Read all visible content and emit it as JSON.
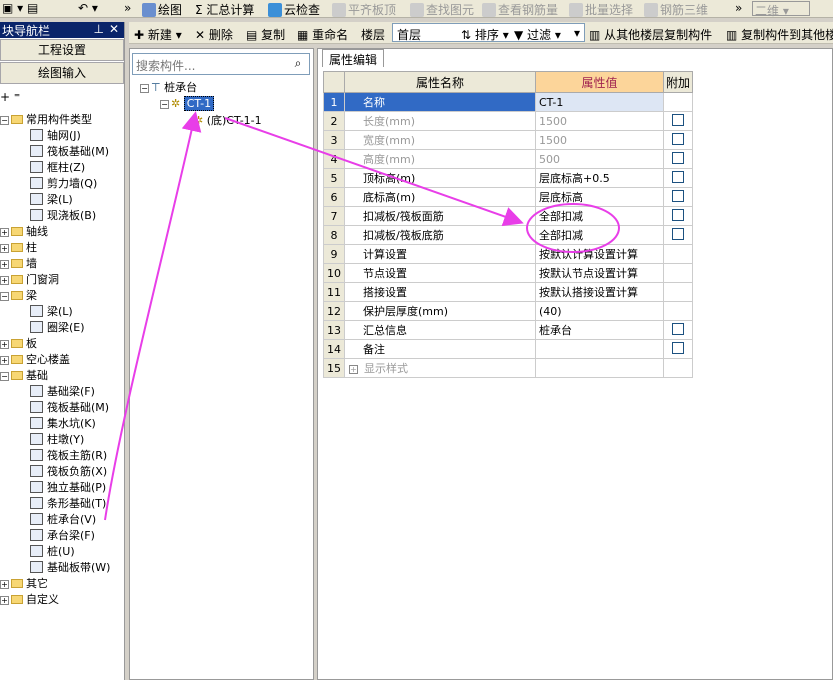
{
  "toolbar": {
    "items": [
      "绘图",
      "汇总计算",
      "云检查",
      "平齐板顶",
      "查找图元",
      "查看钢筋量",
      "批量选择",
      "钢筋三维"
    ],
    "view_mode": "二维"
  },
  "nav": {
    "title": "模块导航栏",
    "title_visible": "块导航栏",
    "btn_project": "工程设置",
    "btn_draw": "绘图输入",
    "items": {
      "common": "常用构件类型",
      "grid": "轴网(J)",
      "raft": "筏板基础(M)",
      "column_frame": "框柱(Z)",
      "shear_wall": "剪力墙(Q)",
      "beam": "梁(L)",
      "slab": "现浇板(B)",
      "axis": "轴线",
      "col": "柱",
      "wall": "墙",
      "door": "门窗洞",
      "beam_group": "梁",
      "beam_l": "梁(L)",
      "ring_beam": "圈梁(E)",
      "board": "板",
      "hollow": "空心楼盖",
      "found": "基础",
      "found_beam": "基础梁(F)",
      "raft2": "筏板基础(M)",
      "sump": "集水坑(K)",
      "pier": "柱墩(Y)",
      "raft_main": "筏板主筋(R)",
      "raft_neg": "筏板负筋(X)",
      "isolated": "独立基础(P)",
      "strip": "条形基础(T)",
      "pile_cap": "桩承台(V)",
      "cap_beam": "承台梁(F)",
      "pile": "桩(U)",
      "found_strip": "基础板带(W)",
      "other": "其它",
      "custom": "自定义"
    }
  },
  "mid": {
    "search_placeholder": "搜索构件...",
    "root": "桩承台",
    "child": "CT-1",
    "sub": "(底)CT-1-1"
  },
  "tb2": {
    "new": "新建",
    "delete": "删除",
    "copy": "复制",
    "rename": "重命名",
    "floor_label": "楼层",
    "floor_value": "首层",
    "sort": "排序",
    "filter": "过滤",
    "copy_from": "从其他楼层复制构件",
    "copy_to": "复制构件到其他楼层"
  },
  "panel": {
    "tab": "属性编辑",
    "headers": [
      "属性名称",
      "属性值",
      "附加"
    ],
    "rows": [
      {
        "n": "1",
        "name": "名称",
        "value": "CT-1",
        "cb": false,
        "gray": false
      },
      {
        "n": "2",
        "name": "长度(mm)",
        "value": "1500",
        "cb": true,
        "gray": true
      },
      {
        "n": "3",
        "name": "宽度(mm)",
        "value": "1500",
        "cb": true,
        "gray": true
      },
      {
        "n": "4",
        "name": "高度(mm)",
        "value": "500",
        "cb": true,
        "gray": true
      },
      {
        "n": "5",
        "name": "顶标高(m)",
        "value": "层底标高+0.5",
        "cb": true,
        "gray": false
      },
      {
        "n": "6",
        "name": "底标高(m)",
        "value": "层底标高",
        "cb": true,
        "gray": false
      },
      {
        "n": "7",
        "name": "扣减板/筏板面筋",
        "value": "全部扣减",
        "cb": true,
        "gray": false
      },
      {
        "n": "8",
        "name": "扣减板/筏板底筋",
        "value": "全部扣减",
        "cb": true,
        "gray": false
      },
      {
        "n": "9",
        "name": "计算设置",
        "value": "按默认计算设置计算",
        "cb": false,
        "gray": false
      },
      {
        "n": "10",
        "name": "节点设置",
        "value": "按默认节点设置计算",
        "cb": false,
        "gray": false
      },
      {
        "n": "11",
        "name": "搭接设置",
        "value": "按默认搭接设置计算",
        "cb": false,
        "gray": false
      },
      {
        "n": "12",
        "name": "保护层厚度(mm)",
        "value": "(40)",
        "cb": false,
        "gray": false
      },
      {
        "n": "13",
        "name": "汇总信息",
        "value": "桩承台",
        "cb": true,
        "gray": false
      },
      {
        "n": "14",
        "name": "备注",
        "value": "",
        "cb": true,
        "gray": false
      },
      {
        "n": "15",
        "name": "显示样式",
        "value": "",
        "cb": false,
        "gray": true
      }
    ]
  },
  "colors": {
    "annotation": "#e83ee8",
    "selection": "#316ac5",
    "value_header": "#fcd59a"
  }
}
